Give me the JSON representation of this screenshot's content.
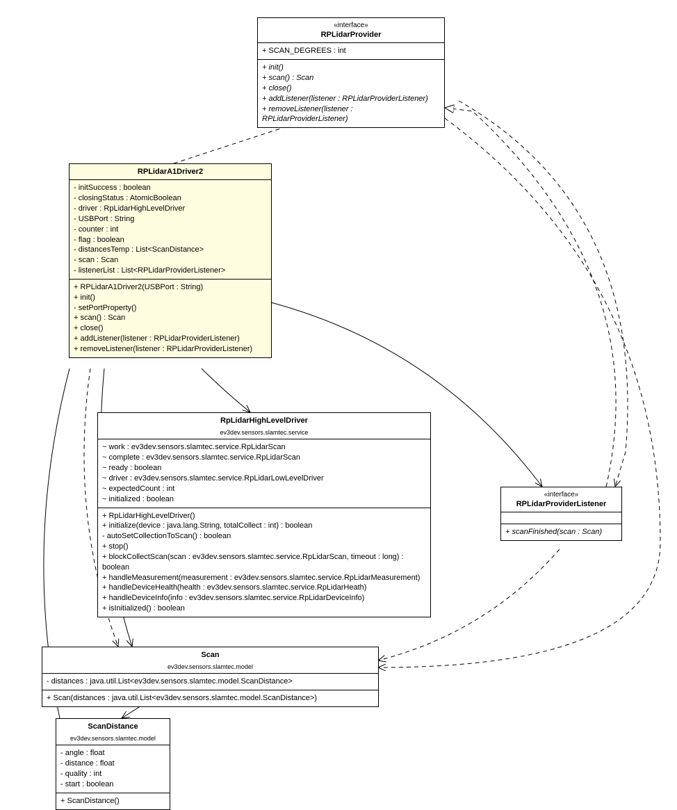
{
  "rplidar_provider": {
    "stereotype": "«interface»",
    "name": "RPLidarProvider",
    "attrs": [
      "+ SCAN_DEGREES : int"
    ],
    "ops": [
      "+ init()",
      "+ scan() : Scan",
      "+ close()",
      "+ addListener(listener : RPLidarProviderListener)",
      "+ removeListener(listener : RPLidarProviderListener)"
    ]
  },
  "driver2": {
    "name": "RPLidarA1Driver2",
    "attrs": [
      "- initSuccess : boolean",
      "- closingStatus : AtomicBoolean",
      "- driver : RpLidarHighLevelDriver",
      "- USBPort : String",
      "- counter : int",
      "- flag : boolean",
      "- distancesTemp : List<ScanDistance>",
      "- scan : Scan",
      "- listenerList : List<RPLidarProviderListener>"
    ],
    "ops": [
      "+ RPLidarA1Driver2(USBPort : String)",
      "+ init()",
      "- setPortProperty()",
      "+ scan() : Scan",
      "+ close()",
      "+ addListener(listener : RPLidarProviderListener)",
      "+ removeListener(listener : RPLidarProviderListener)"
    ]
  },
  "high_level": {
    "name": "RpLidarHighLevelDriver",
    "pkg": "ev3dev.sensors.slamtec.service",
    "attrs": [
      "~ work : ev3dev.sensors.slamtec.service.RpLidarScan",
      "~ complete : ev3dev.sensors.slamtec.service.RpLidarScan",
      "~ ready : boolean",
      "~ driver : ev3dev.sensors.slamtec.service.RpLidarLowLevelDriver",
      "~ expectedCount : int",
      "~ initialized : boolean"
    ],
    "ops": [
      "+ RpLidarHighLevelDriver()",
      "+ initialize(device : java.lang.String, totalCollect : int) : boolean",
      "- autoSetCollectionToScan() : boolean",
      "+ stop()",
      "+ blockCollectScan(scan : ev3dev.sensors.slamtec.service.RpLidarScan, timeout : long) : boolean",
      "+ handleMeasurement(measurement : ev3dev.sensors.slamtec.service.RpLidarMeasurement)",
      "+ handleDeviceHealth(health : ev3dev.sensors.slamtec.service.RpLidarHeath)",
      "+ handleDeviceInfo(info : ev3dev.sensors.slamtec.service.RpLidarDeviceInfo)",
      "+ isInitialized() : boolean"
    ]
  },
  "listener": {
    "stereotype": "«interface»",
    "name": "RPLidarProviderListener",
    "ops": [
      "+ scanFinished(scan : Scan)"
    ]
  },
  "scan": {
    "name": "Scan",
    "pkg": "ev3dev.sensors.slamtec.model",
    "attrs": [
      "- distances : java.util.List<ev3dev.sensors.slamtec.model.ScanDistance>"
    ],
    "ops": [
      "+ Scan(distances : java.util.List<ev3dev.sensors.slamtec.model.ScanDistance>)"
    ]
  },
  "scan_distance": {
    "name": "ScanDistance",
    "pkg": "ev3dev.sensors.slamtec.model",
    "attrs": [
      "- angle : float",
      "- distance : float",
      "- quality : int",
      "- start : boolean"
    ],
    "ops": [
      "+ ScanDistance()"
    ]
  }
}
